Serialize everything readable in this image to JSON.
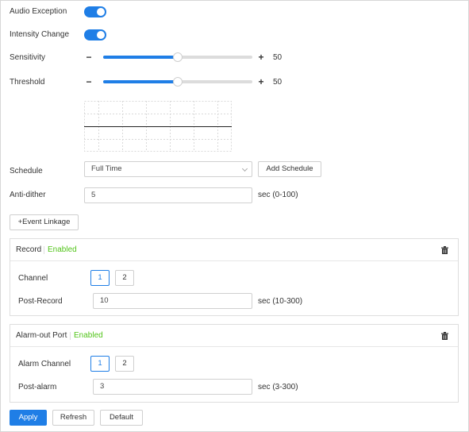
{
  "audio_exception": {
    "label": "Audio Exception",
    "enabled": true
  },
  "intensity_change": {
    "label": "Intensity Change",
    "enabled": true
  },
  "sensitivity": {
    "label": "Sensitivity",
    "minus": "−",
    "plus": "+",
    "value": "50",
    "level": 50
  },
  "threshold": {
    "label": "Threshold",
    "minus": "−",
    "plus": "+",
    "value": "50",
    "level": 50
  },
  "schedule": {
    "label": "Schedule",
    "selected": "Full Time",
    "add_button": "Add Schedule"
  },
  "anti_dither": {
    "label": "Anti-dither",
    "value": "5",
    "unit": "sec (0-100)"
  },
  "event_linkage_button": "+Event Linkage",
  "record_panel": {
    "title": "Record",
    "status": "Enabled",
    "channel_label": "Channel",
    "channels": [
      "1",
      "2"
    ],
    "selected_channel": "1",
    "post_label": "Post-Record",
    "post_value": "10",
    "post_unit": "sec (10-300)"
  },
  "alarm_panel": {
    "title": "Alarm-out Port",
    "status": "Enabled",
    "channel_label": "Alarm Channel",
    "channels": [
      "1",
      "2"
    ],
    "selected_channel": "1",
    "post_label": "Post-alarm",
    "post_value": "3",
    "post_unit": "sec (3-300)"
  },
  "footer": {
    "apply": "Apply",
    "refresh": "Refresh",
    "default": "Default"
  },
  "colors": {
    "accent": "#1f7ee6",
    "enabled": "#52c41a",
    "border": "#d0d0d0"
  }
}
